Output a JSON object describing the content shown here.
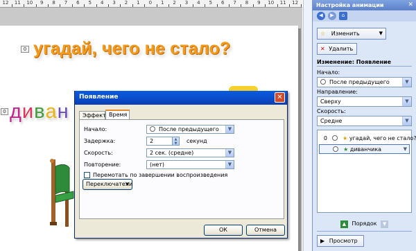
{
  "ruler_numbers": [
    "12",
    "11",
    "10",
    "9",
    "8",
    "7",
    "6",
    "5",
    "4",
    "3",
    "2",
    "1",
    "0",
    "1",
    "2",
    "3",
    "4",
    "5",
    "6",
    "7",
    "8",
    "9",
    "10",
    "11",
    "12"
  ],
  "slide": {
    "title_tag": "0",
    "title_text": "угадай, чего не стало?",
    "divan_tag": "0",
    "divan_letters": [
      "д",
      "и",
      "в",
      "а",
      "н"
    ],
    "divan_colors": [
      "#c0278e",
      "#d8365a",
      "#3f9d3c",
      "#e9b312",
      "#6b4cb8"
    ]
  },
  "dialog": {
    "title": "Появление",
    "close_glyph": "✕",
    "tabs": [
      "Эффект",
      "Время"
    ],
    "start_label": "Начало:",
    "start_value": "После предыдущего",
    "delay_label": "Задержка:",
    "delay_value": "2",
    "delay_unit": "секунд",
    "speed_label": "Скорость:",
    "speed_value": "2 сек. (средне)",
    "repeat_label": "Повторение:",
    "repeat_value": "(нет)",
    "rewind_label": "Перемотать по завершении воспроизведения",
    "switch_button": "Переключатели",
    "ok": "ОК",
    "cancel": "Отмена"
  },
  "pane": {
    "title": "Настройка анимации",
    "close_glyph": "✕",
    "change_button": "Изменить",
    "delete_button": "Удалить",
    "section_title": "Изменение: Появление",
    "start_label": "Начало:",
    "start_value": "После предыдущего",
    "direction_label": "Направление:",
    "direction_value": "Сверху",
    "speed_label": "Скорость:",
    "speed_value": "Средне",
    "list": [
      {
        "num": "0",
        "text": "угадай, чего не стало?"
      },
      {
        "num": "",
        "text": "диванчика"
      }
    ],
    "order_label": "Порядок",
    "preview_button": "Просмотр"
  },
  "colors": {
    "title_orange": "#f39a1c",
    "xp_blue": "#0a4bc7",
    "pane_bg": "#dbe6f7"
  }
}
